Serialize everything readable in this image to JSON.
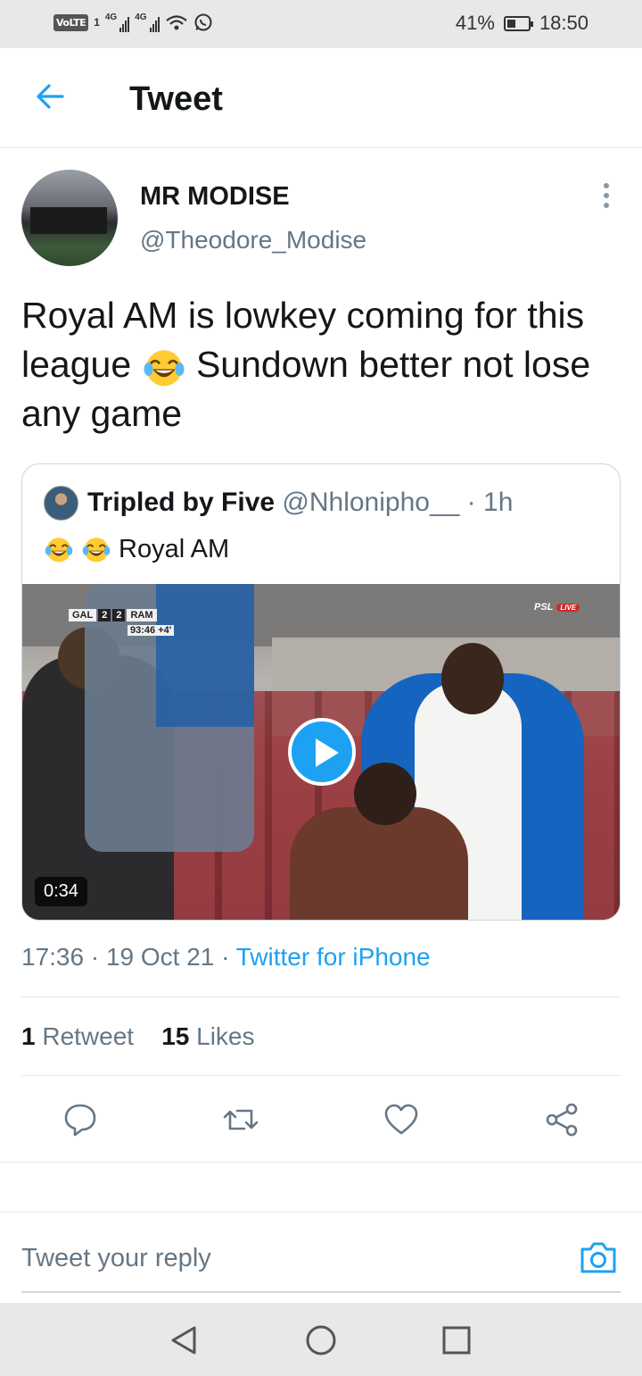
{
  "status_bar": {
    "volte": "VoLTE",
    "sim": "1",
    "net1": "4G",
    "net2": "4G",
    "battery": "41%",
    "battery_level": 0.41,
    "time": "18:50"
  },
  "header": {
    "title": "Tweet",
    "back_icon": "arrow-left-icon"
  },
  "tweet": {
    "author_name": "MR MODISE",
    "author_handle": "@Theodore_Modise",
    "text_part1": "Royal AM is lowkey coming for this league",
    "text_part2": "Sundown better not lose any game",
    "timestamp": "17:36 · 19 Oct 21 · ",
    "source": "Twitter for iPhone",
    "retweet_count": "1",
    "retweet_label": "Retweet",
    "like_count": "15",
    "like_label": "Likes"
  },
  "quoted": {
    "name": "Tripled by Five",
    "handle": "@Nhlonipho__",
    "age": " · 1h",
    "text": "Royal AM",
    "video": {
      "score_home": "GAL",
      "score_home_goals": "2",
      "score_away_goals": "2",
      "score_away": "RAM",
      "clock": "93:46",
      "added": "+4'",
      "broadcaster": "PSL",
      "live": "LIVE",
      "duration": "0:34"
    }
  },
  "reply": {
    "placeholder": "Tweet your reply"
  },
  "colors": {
    "accent": "#1da1f2",
    "secondary_text": "#657786",
    "primary_text": "#14171a"
  }
}
